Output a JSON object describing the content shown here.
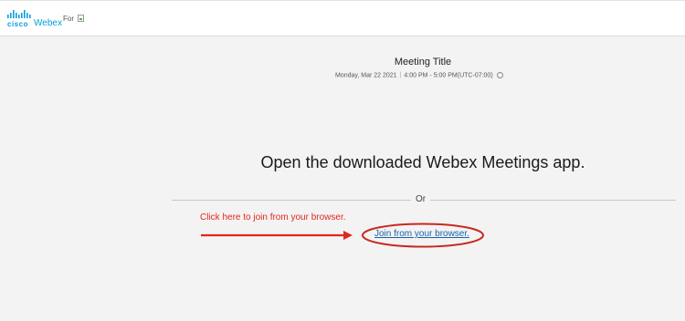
{
  "header": {
    "logo": {
      "cisco_text": "cisco",
      "product_text": "Webex"
    },
    "for_text": "For",
    "broken_image_icon": "broken-image-icon"
  },
  "meeting": {
    "title": "Meeting Title",
    "date": "Monday, Mar 22 2021",
    "separator": "|",
    "time": "4:00 PM - 5:00 PM(UTC-07:00)",
    "info_icon": "info-icon"
  },
  "main": {
    "open_app_text": "Open the downloaded Webex Meetings app.",
    "or_text": "Or",
    "join_link_text": "Join from your browser."
  },
  "annotation": {
    "text": "Click here to join from your browser.",
    "color": "#e0271e"
  },
  "colors": {
    "brand": "#049fd9",
    "link": "#1863a8",
    "background": "#f3f3f3",
    "annotation_red": "#e0271e"
  }
}
